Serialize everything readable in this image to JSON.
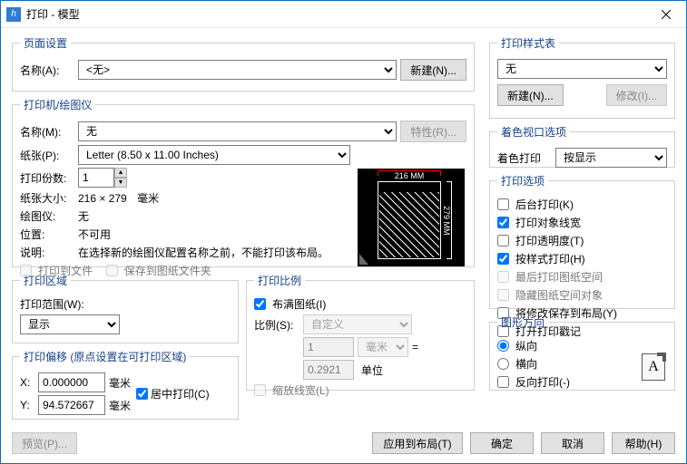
{
  "window": {
    "title": "打印 - 模型"
  },
  "pageSetup": {
    "legend": "页面设置",
    "nameLabel": "名称(A):",
    "nameValue": "<无>",
    "newBtn": "新建(N)..."
  },
  "printer": {
    "legend": "打印机/绘图仪",
    "nameLabel": "名称(M):",
    "nameValue": "无",
    "propsBtn": "特性(R)...",
    "paperLabel": "纸张(P):",
    "paperValue": "Letter (8.50 x 11.00 Inches)",
    "copiesLabel": "打印份数:",
    "copies": "1",
    "sizeLabel": "纸张大小:",
    "sizeValue": "216 × 279",
    "sizeUnit": "毫米",
    "plotterLabel": "绘图仪:",
    "plotterValue": "无",
    "posLabel": "位置:",
    "posValue": "不可用",
    "descLabel": "说明:",
    "descValue": "在选择新的绘图仪配置名称之前，不能打印该布局。",
    "toFile": "打印到文件",
    "toFolder": "保存到图纸文件夹",
    "dimW": "216 MM",
    "dimH": "279 MM"
  },
  "area": {
    "legend": "打印区域",
    "rangeLabel": "打印范围(W):",
    "rangeValue": "显示"
  },
  "scale": {
    "legend": "打印比例",
    "fit": "布满图纸(I)",
    "ratioLabel": "比例(S):",
    "ratioValue": "自定义",
    "num": "1",
    "unit1": "毫米",
    "eq": "=",
    "den": "0.2921",
    "unit2": "单位",
    "scaleLw": "缩放线宽(L)"
  },
  "offset": {
    "legend": "打印偏移 (原点设置在可打印区域)",
    "xLabel": "X:",
    "xVal": "0.000000",
    "yLabel": "Y:",
    "yVal": "94.572667",
    "unit": "毫米",
    "center": "居中打印(C)"
  },
  "styleTable": {
    "legend": "打印样式表",
    "value": "无",
    "newBtn": "新建(N)...",
    "editBtn": "修改(I)..."
  },
  "shade": {
    "legend": "着色视口选项",
    "label": "着色打印",
    "value": "按显示"
  },
  "popt": {
    "legend": "打印选项",
    "bg": "后台打印(K)",
    "lw": "打印对象线宽",
    "trans": "打印透明度(T)",
    "style": "按样式打印(H)",
    "last": "最后打印图纸空间",
    "hide": "隐藏图纸空间对象",
    "save": "将修改保存到布局(Y)",
    "stamp": "打开打印戳记"
  },
  "orient": {
    "legend": "图形方向",
    "portrait": "纵向",
    "landscape": "横向",
    "reverse": "反向打印(-)"
  },
  "footer": {
    "preview": "预览(P)...",
    "apply": "应用到布局(T)",
    "ok": "确定",
    "cancel": "取消",
    "help": "帮助(H)"
  }
}
